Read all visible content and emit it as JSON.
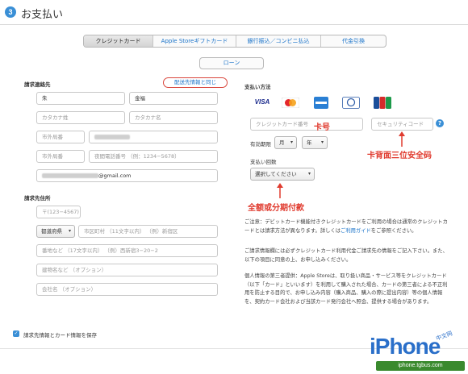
{
  "header": {
    "step_number": "3",
    "title": "お支払い"
  },
  "tabs": [
    {
      "label": "クレジットカード",
      "active": true
    },
    {
      "label": "Apple Storeギフトカード",
      "active": false
    },
    {
      "label": "銀行振込／コンビニ払込",
      "active": false
    },
    {
      "label": "代金引換",
      "active": false
    }
  ],
  "loan_button": "ローン",
  "billing": {
    "section_label": "請求連絡先",
    "ship_same_link": "配送先情報と同じ",
    "last_name": "朱",
    "first_name": "金福",
    "kana_last_placeholder": "カタカナ姓",
    "kana_first_placeholder": "カタカナ名",
    "area_code_placeholder": "市外局番",
    "night_phone_placeholder": "夜間電話番号 （例：1234−5678）",
    "email_suffix": "@gmail.com"
  },
  "billing_address": {
    "section_label": "請求先住所",
    "postal_placeholder": "〒(123−4567)",
    "prefecture_select": "都道府県",
    "city_placeholder": "市区町村 （11文字以内） （例）新宿区",
    "street_placeholder": "番地など （17文字以内） （例）西新宿3−20−2",
    "building_placeholder": "建物名など （オプション）",
    "company_placeholder": "会社名 （オプション）"
  },
  "payment": {
    "section_label": "支払い方法",
    "card_logos": [
      "VISA",
      "MasterCard",
      "AMEX",
      "Diners Club",
      "JCB"
    ],
    "card_number_placeholder": "クレジットカード番号",
    "security_code_placeholder": "セキュリティコード",
    "expiry_label": "有効期限",
    "month_select": "月",
    "year_select": "年",
    "installments_label": "支払い回数",
    "installments_select": "選択してください"
  },
  "annotations": {
    "card_number": "卡号",
    "security_code": "卡背面三位安全码",
    "installments": "全额或分期付款"
  },
  "notices": {
    "p1_before_link": "ご注意：デビットカード機能付きクレジットカードをご利用の場合は通常のクレジットカードとは請求方法が異なります。詳しくは",
    "p1_link": "ご利用ガイド",
    "p1_after_link": "をご参照ください。",
    "p2": "ご請求情報欄には必ずクレジットカード利用代金ご請求先の情報をご記入下さい。また、以下の項目に同意の上、お申し込みください。",
    "p3": "個人情報の第三者提供：Apple Storeは、取り扱い商品・サービス等をクレジットカード（以下「カード」といいます）を利用して購入された場合、カードの第三者による不正利用を防止する目的で、お申し込み内容（購入商品、購入の際に提出内容）等の個人情報を、契約カード会社および当該カード発行会社へ照会、提供する場合があります。"
  },
  "save_checkbox_label": "請求先情報とカード情報を保存",
  "watermark": {
    "brand": "iPhone",
    "sub": "中文网",
    "url": "iphone.tgbus.com"
  }
}
